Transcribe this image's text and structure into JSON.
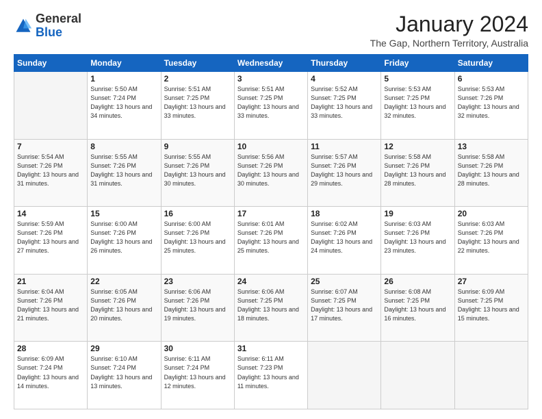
{
  "header": {
    "logo": {
      "general": "General",
      "blue": "Blue"
    },
    "title": "January 2024",
    "location": "The Gap, Northern Territory, Australia"
  },
  "days_of_week": [
    "Sunday",
    "Monday",
    "Tuesday",
    "Wednesday",
    "Thursday",
    "Friday",
    "Saturday"
  ],
  "weeks": [
    [
      {
        "day": "",
        "sunrise": "",
        "sunset": "",
        "daylight": ""
      },
      {
        "day": "1",
        "sunrise": "Sunrise: 5:50 AM",
        "sunset": "Sunset: 7:24 PM",
        "daylight": "Daylight: 13 hours and 34 minutes."
      },
      {
        "day": "2",
        "sunrise": "Sunrise: 5:51 AM",
        "sunset": "Sunset: 7:25 PM",
        "daylight": "Daylight: 13 hours and 33 minutes."
      },
      {
        "day": "3",
        "sunrise": "Sunrise: 5:51 AM",
        "sunset": "Sunset: 7:25 PM",
        "daylight": "Daylight: 13 hours and 33 minutes."
      },
      {
        "day": "4",
        "sunrise": "Sunrise: 5:52 AM",
        "sunset": "Sunset: 7:25 PM",
        "daylight": "Daylight: 13 hours and 33 minutes."
      },
      {
        "day": "5",
        "sunrise": "Sunrise: 5:53 AM",
        "sunset": "Sunset: 7:25 PM",
        "daylight": "Daylight: 13 hours and 32 minutes."
      },
      {
        "day": "6",
        "sunrise": "Sunrise: 5:53 AM",
        "sunset": "Sunset: 7:26 PM",
        "daylight": "Daylight: 13 hours and 32 minutes."
      }
    ],
    [
      {
        "day": "7",
        "sunrise": "Sunrise: 5:54 AM",
        "sunset": "Sunset: 7:26 PM",
        "daylight": "Daylight: 13 hours and 31 minutes."
      },
      {
        "day": "8",
        "sunrise": "Sunrise: 5:55 AM",
        "sunset": "Sunset: 7:26 PM",
        "daylight": "Daylight: 13 hours and 31 minutes."
      },
      {
        "day": "9",
        "sunrise": "Sunrise: 5:55 AM",
        "sunset": "Sunset: 7:26 PM",
        "daylight": "Daylight: 13 hours and 30 minutes."
      },
      {
        "day": "10",
        "sunrise": "Sunrise: 5:56 AM",
        "sunset": "Sunset: 7:26 PM",
        "daylight": "Daylight: 13 hours and 30 minutes."
      },
      {
        "day": "11",
        "sunrise": "Sunrise: 5:57 AM",
        "sunset": "Sunset: 7:26 PM",
        "daylight": "Daylight: 13 hours and 29 minutes."
      },
      {
        "day": "12",
        "sunrise": "Sunrise: 5:58 AM",
        "sunset": "Sunset: 7:26 PM",
        "daylight": "Daylight: 13 hours and 28 minutes."
      },
      {
        "day": "13",
        "sunrise": "Sunrise: 5:58 AM",
        "sunset": "Sunset: 7:26 PM",
        "daylight": "Daylight: 13 hours and 28 minutes."
      }
    ],
    [
      {
        "day": "14",
        "sunrise": "Sunrise: 5:59 AM",
        "sunset": "Sunset: 7:26 PM",
        "daylight": "Daylight: 13 hours and 27 minutes."
      },
      {
        "day": "15",
        "sunrise": "Sunrise: 6:00 AM",
        "sunset": "Sunset: 7:26 PM",
        "daylight": "Daylight: 13 hours and 26 minutes."
      },
      {
        "day": "16",
        "sunrise": "Sunrise: 6:00 AM",
        "sunset": "Sunset: 7:26 PM",
        "daylight": "Daylight: 13 hours and 25 minutes."
      },
      {
        "day": "17",
        "sunrise": "Sunrise: 6:01 AM",
        "sunset": "Sunset: 7:26 PM",
        "daylight": "Daylight: 13 hours and 25 minutes."
      },
      {
        "day": "18",
        "sunrise": "Sunrise: 6:02 AM",
        "sunset": "Sunset: 7:26 PM",
        "daylight": "Daylight: 13 hours and 24 minutes."
      },
      {
        "day": "19",
        "sunrise": "Sunrise: 6:03 AM",
        "sunset": "Sunset: 7:26 PM",
        "daylight": "Daylight: 13 hours and 23 minutes."
      },
      {
        "day": "20",
        "sunrise": "Sunrise: 6:03 AM",
        "sunset": "Sunset: 7:26 PM",
        "daylight": "Daylight: 13 hours and 22 minutes."
      }
    ],
    [
      {
        "day": "21",
        "sunrise": "Sunrise: 6:04 AM",
        "sunset": "Sunset: 7:26 PM",
        "daylight": "Daylight: 13 hours and 21 minutes."
      },
      {
        "day": "22",
        "sunrise": "Sunrise: 6:05 AM",
        "sunset": "Sunset: 7:26 PM",
        "daylight": "Daylight: 13 hours and 20 minutes."
      },
      {
        "day": "23",
        "sunrise": "Sunrise: 6:06 AM",
        "sunset": "Sunset: 7:26 PM",
        "daylight": "Daylight: 13 hours and 19 minutes."
      },
      {
        "day": "24",
        "sunrise": "Sunrise: 6:06 AM",
        "sunset": "Sunset: 7:25 PM",
        "daylight": "Daylight: 13 hours and 18 minutes."
      },
      {
        "day": "25",
        "sunrise": "Sunrise: 6:07 AM",
        "sunset": "Sunset: 7:25 PM",
        "daylight": "Daylight: 13 hours and 17 minutes."
      },
      {
        "day": "26",
        "sunrise": "Sunrise: 6:08 AM",
        "sunset": "Sunset: 7:25 PM",
        "daylight": "Daylight: 13 hours and 16 minutes."
      },
      {
        "day": "27",
        "sunrise": "Sunrise: 6:09 AM",
        "sunset": "Sunset: 7:25 PM",
        "daylight": "Daylight: 13 hours and 15 minutes."
      }
    ],
    [
      {
        "day": "28",
        "sunrise": "Sunrise: 6:09 AM",
        "sunset": "Sunset: 7:24 PM",
        "daylight": "Daylight: 13 hours and 14 minutes."
      },
      {
        "day": "29",
        "sunrise": "Sunrise: 6:10 AM",
        "sunset": "Sunset: 7:24 PM",
        "daylight": "Daylight: 13 hours and 13 minutes."
      },
      {
        "day": "30",
        "sunrise": "Sunrise: 6:11 AM",
        "sunset": "Sunset: 7:24 PM",
        "daylight": "Daylight: 13 hours and 12 minutes."
      },
      {
        "day": "31",
        "sunrise": "Sunrise: 6:11 AM",
        "sunset": "Sunset: 7:23 PM",
        "daylight": "Daylight: 13 hours and 11 minutes."
      },
      {
        "day": "",
        "sunrise": "",
        "sunset": "",
        "daylight": ""
      },
      {
        "day": "",
        "sunrise": "",
        "sunset": "",
        "daylight": ""
      },
      {
        "day": "",
        "sunrise": "",
        "sunset": "",
        "daylight": ""
      }
    ]
  ]
}
